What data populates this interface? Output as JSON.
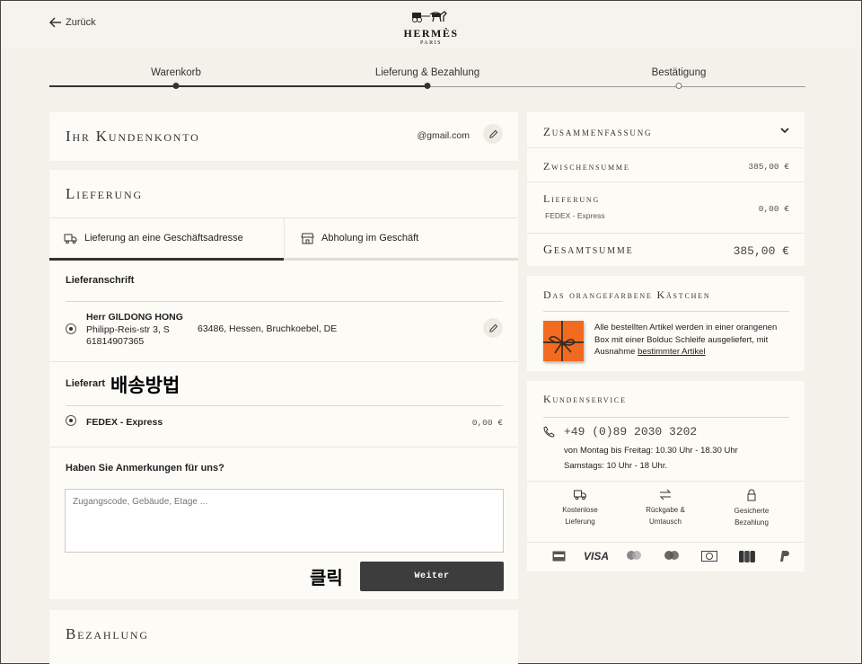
{
  "header": {
    "back_label": "Zurück",
    "brand": "HERMÈS",
    "city": "PARIS"
  },
  "progress": {
    "steps": [
      {
        "label": "Warenkorb",
        "state": "done"
      },
      {
        "label": "Lieferung & Bezahlung",
        "state": "current"
      },
      {
        "label": "Bestätigung",
        "state": "todo"
      }
    ]
  },
  "account": {
    "title": "Ihr Kundenkonto",
    "email": "@gmail.com"
  },
  "delivery": {
    "title": "Lieferung",
    "tabs": [
      {
        "label": "Lieferung an eine Geschäftsadresse",
        "active": true
      },
      {
        "label": "Abholung im Geschäft",
        "active": false
      }
    ],
    "address_heading": "Lieferanschrift",
    "address": {
      "name": "Herr GILDONG HONG",
      "street": "Philipp-Reis-str 3,  S",
      "city": "63486, Hessen, Bruchkoebel,  DE",
      "phone": "61814907365"
    },
    "method_heading": "Lieferart",
    "method_annotation": "배송방법",
    "method": {
      "name": "FEDEX - Express",
      "price": "0,00 €"
    },
    "remarks_heading": "Haben Sie Anmerkungen für uns?",
    "remarks_placeholder": "Zugangscode, Gebäude, Etage ...",
    "click_annotation": "클릭",
    "continue_label": "Weiter"
  },
  "payment": {
    "title": "Bezahlung"
  },
  "summary": {
    "title": "Zusammenfassung",
    "subtotal_label": "Zwischensumme",
    "subtotal_value": "385,00 €",
    "shipping_label": "Lieferung",
    "shipping_sub": "FEDEX - Express",
    "shipping_value": "0,00 €",
    "total_label": "Gesamtsumme",
    "total_value": "385,00 €"
  },
  "orange_box": {
    "title": "Das orangefarbene Kästchen",
    "text": "Alle bestellten Artikel werden in einer orangenen Box mit einer Bolduc Schleife ausgeliefert, mit Ausnahme ",
    "link": "bestimmter Artikel"
  },
  "service": {
    "title": "Kundenservice",
    "phone": "+49 (0)89 2030 3202",
    "hours_1": "von Montag bis Freitag: 10.30 Uhr - 18.30 Uhr",
    "hours_2": "Samstags: 10 Uhr - 18 Uhr.",
    "features": [
      {
        "icon": "truck-icon",
        "line1": "Kostenlose",
        "line2": "Lieferung"
      },
      {
        "icon": "exchange-icon",
        "line1": "Rückgabe &",
        "line2": "Umtausch"
      },
      {
        "icon": "secure-lock-icon",
        "line1": "Gesicherte",
        "line2": "Bezahlung"
      }
    ],
    "payment_methods": [
      "amex-icon",
      "visa-icon",
      "mastercard-icon",
      "maestro-icon",
      "diners-icon",
      "jcb-icon",
      "paypal-icon"
    ],
    "visa_text": "VISA"
  },
  "colors": {
    "background": "#f4f0ea",
    "card": "#fdfbf6",
    "button": "#3d3d3d",
    "orange": "#f06b1f"
  }
}
